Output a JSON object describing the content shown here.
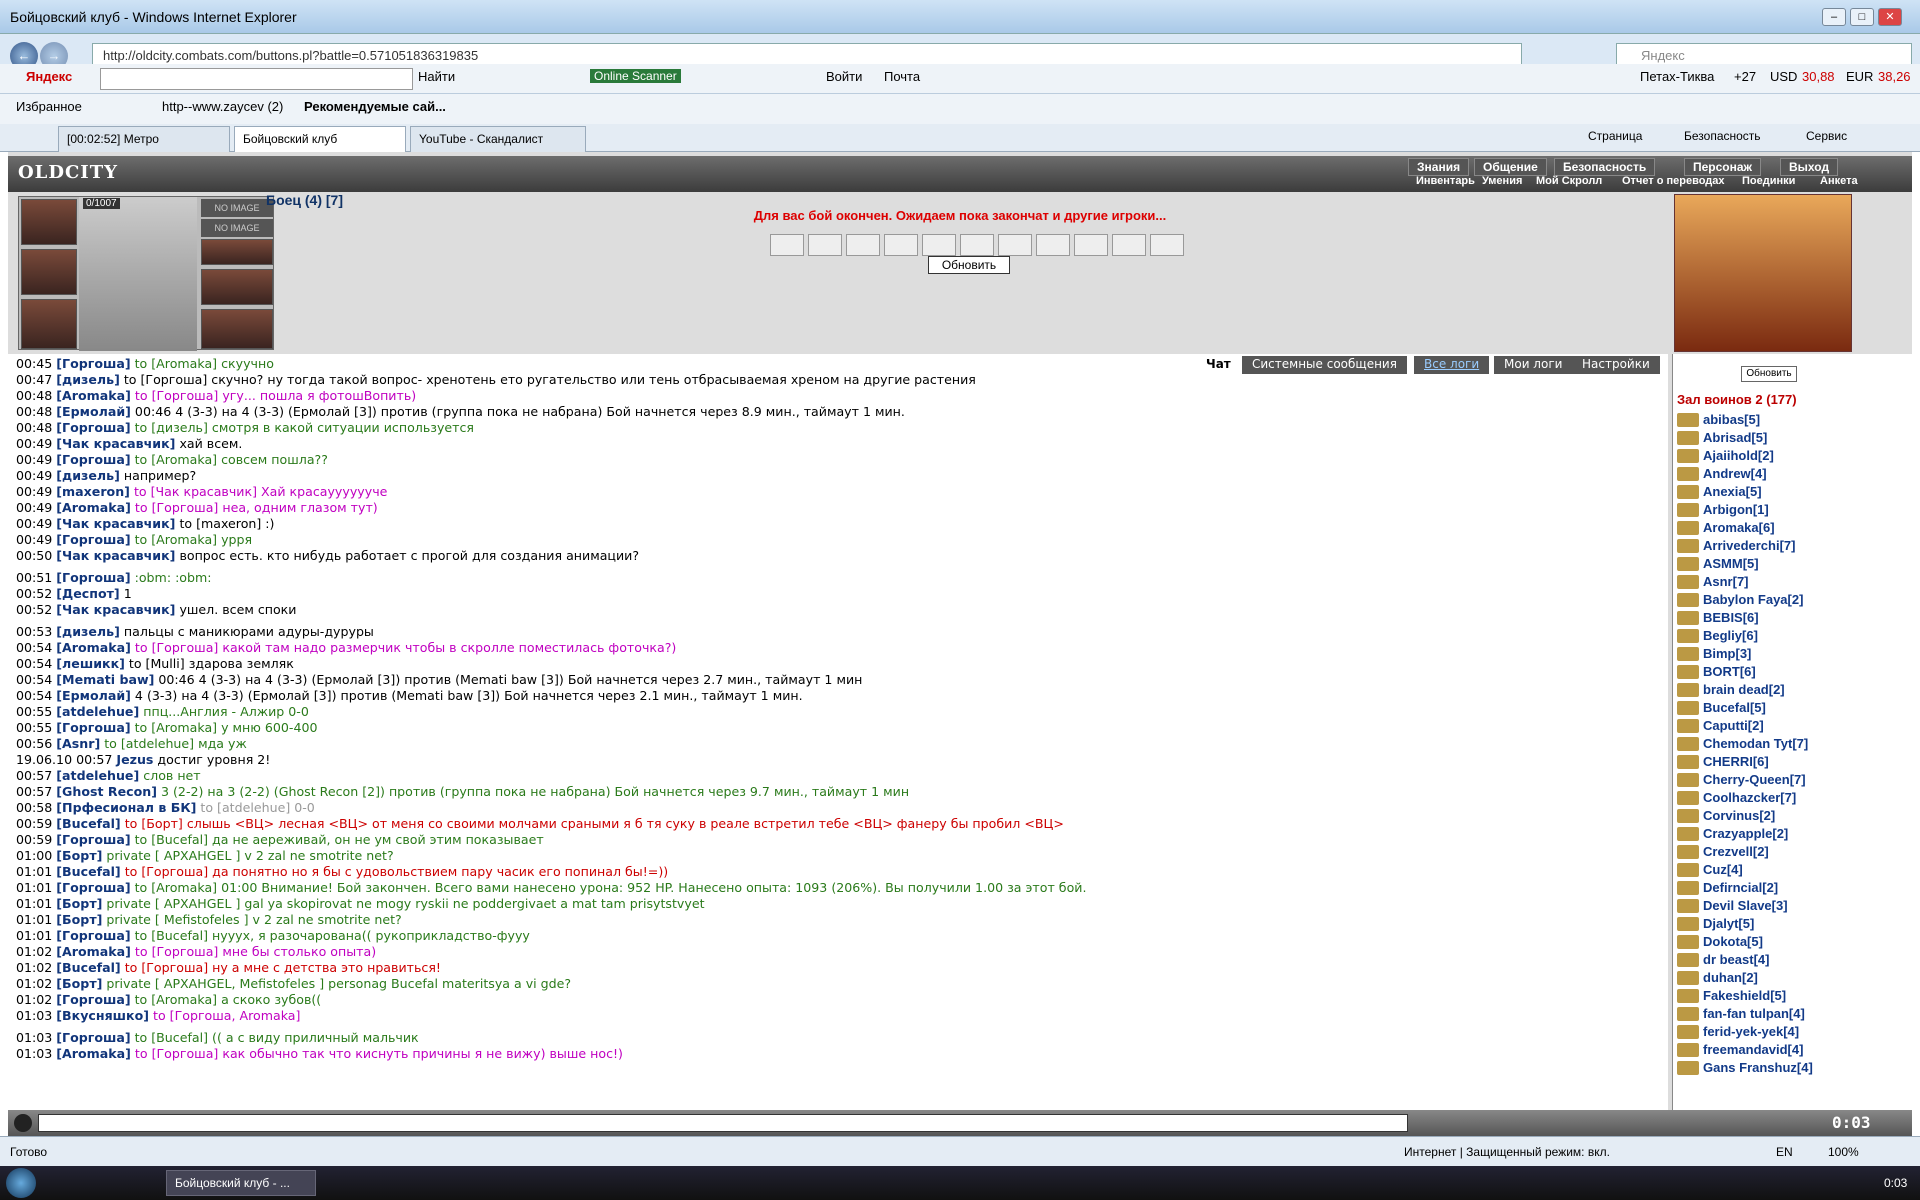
{
  "window": {
    "title": "Бойцовский клуб - Windows Internet Explorer"
  },
  "address": {
    "url": "http://oldcity.combats.com/buttons.pl?battle=0.571051836319835",
    "search_placeholder": "Яндекс"
  },
  "toolbar": {
    "yandex": "Яндекс",
    "find": "Найти",
    "online_scanner": "Online Scanner",
    "login": "Войти",
    "mail": "Почта",
    "location": "Петах-Тиква",
    "temp": "+27",
    "usd_label": "USD",
    "usd": "30,88",
    "eur_label": "EUR",
    "eur": "38,26"
  },
  "favorites": {
    "label": "Избранное",
    "link1": "http--www.zaycev (2)",
    "link2": "Рекомендуемые сай..."
  },
  "tabs": [
    {
      "label": "[00:02:52] Метро"
    },
    {
      "label": "Бойцовский клуб"
    },
    {
      "label": "YouTube - Скандалист"
    }
  ],
  "ie_menu": {
    "page": "Страница",
    "safety": "Безопасность",
    "service": "Сервис"
  },
  "game": {
    "logo": "OLDCITY",
    "menu_top": [
      "Знания",
      "Общение",
      "Безопасность",
      "Персонаж",
      "Выход"
    ],
    "menu_bottom": [
      "Инвентарь",
      "Умения",
      "Мой Скролл",
      "Отчет о переводах",
      "Поединки",
      "Анкета"
    ],
    "hp": "0/1007",
    "no_image": "NO IMAGE",
    "hero": "Боец (4) [7]",
    "battle_message": "Для вас бой окончен. Ожидаем пока закончат и другие игроки...",
    "refresh": "Обновить",
    "chat_tabs": [
      "Чат",
      "Системные сообщения",
      "Все логи",
      "Мои логи",
      "Настройки"
    ],
    "hall": "Зал воинов 2 (177)",
    "side_refresh": "Обновить",
    "time": "0:03"
  },
  "chat": [
    [
      "00:45 ",
      "[Горгоша]",
      " to [Aromaka] скуучно",
      "g"
    ],
    [
      "00:47 ",
      "[дизель]",
      " to [Горгоша] скучно? ну тогда такой вопрос- хренотень ето ругательство или тень отбрасываемая хреном на другие растения",
      "t"
    ],
    [
      "00:48 ",
      "[Aromaka]",
      " to [Горгоша] угу... пошла я фотошВопить)",
      "m"
    ],
    [
      "00:48 ",
      "[Ермолай]",
      " 00:46 4 (3-3) на 4 (3-3) (Ермолай [3]) против (группа пока не набрана) Бой начнется через 8.9 мин., таймаут 1 мин.",
      "t"
    ],
    [
      "00:48 ",
      "[Горгоша]",
      " to [дизель] смотря в какой ситуации используется",
      "g"
    ],
    [
      "00:49 ",
      "[Чак красавчик]",
      " хай всем.",
      "t"
    ],
    [
      "00:49 ",
      "[Горгоша]",
      " to [Aromaka] совсем пошла??",
      "g"
    ],
    [
      "00:49 ",
      "[дизель]",
      " например?",
      "t"
    ],
    [
      "00:49 ",
      "[maxeron]",
      " to [Чак красавчик] Хай красаууууууче",
      "m"
    ],
    [
      "00:49 ",
      "[Aromaka]",
      " to [Горгоша] неа, одним глазом тут)",
      "m"
    ],
    [
      "00:49 ",
      "[Чак красавчик]",
      " to [maxeron] :)",
      "t"
    ],
    [
      "00:49 ",
      "[Горгоша]",
      " to [Aromaka] урря",
      "g"
    ],
    [
      "00:50 ",
      "[Чак красавчик]",
      " вопрос есть. кто нибудь работает с прогой для создания анимации?",
      "t"
    ],
    [
      "00:51 ",
      "[Горгоша]",
      " :obm: :obm:",
      "g"
    ],
    [
      "00:52 ",
      "[Деспот]",
      " 1",
      "t"
    ],
    [
      "00:52 ",
      "[Чак красавчик]",
      " ушел. всем споки",
      "t"
    ],
    [
      "00:53 ",
      "[дизель]",
      " пальцы с маникюрами адуры-дуруры",
      "t"
    ],
    [
      "00:54 ",
      "[Aromaka]",
      " to [Горгоша] какой там надо размерчик чтобы в скролле поместилась фоточка?)",
      "m"
    ],
    [
      "00:54 ",
      "[лешикк]",
      " to [Mulli] здарова земляк",
      "t"
    ],
    [
      "00:54 ",
      "[Memati baw]",
      " 00:46 4 (3-3) на 4 (3-3) (Ермолай [3]) против (Memati baw [3]) Бой начнется через 2.7 мин., таймаут 1 мин",
      "t"
    ],
    [
      "00:54 ",
      "[Ермолай]",
      " 4 (3-3) на 4 (3-3) (Ермолай [3]) против (Memati baw [3]) Бой начнется через 2.1 мин., таймаут 1 мин.",
      "t"
    ],
    [
      "00:55 ",
      "[atdelehue]",
      " ппц...Англия - Алжир 0-0",
      "g"
    ],
    [
      "00:55 ",
      "[Горгоша]",
      " to [Aromaka] у мню 600-400",
      "g"
    ],
    [
      "00:56 ",
      "[Asnr]",
      " to [atdelehue] мда уж",
      "g"
    ],
    [
      "19.06.10 00:57 ",
      "Jezus",
      " достиг уровня 2!",
      "t"
    ],
    [
      "00:57 ",
      "[atdelehue]",
      " слов нет",
      "g"
    ],
    [
      "00:57 ",
      "[Ghost Recon]",
      " 3 (2-2) на 3 (2-2) (Ghost Recon [2]) против (группа пока не набрана) Бой начнется через 9.7 мин., таймаут 1 мин",
      "g"
    ],
    [
      "00:58 ",
      "[Прфесионал в БК]",
      " to [atdelehue]    0-0",
      "gr"
    ],
    [
      "00:59 ",
      "[Bucefal]",
      " to [Борт] слышь <ВЦ> лесная <ВЦ> от меня со своими молчами сраными я б тя суку в реале встретил тебе <ВЦ> фанеру бы пробил <ВЦ>",
      "r"
    ],
    [
      "00:59 ",
      "[Горгоша]",
      " to [Bucefal] да не аереживай, он не ум свой этим показывает",
      "g"
    ],
    [
      "01:00 ",
      "[Борт]",
      " private [ АРХАНGEL ] v 2 zal ne smotrite net?",
      "g"
    ],
    [
      "01:01 ",
      "[Bucefal]",
      " to [Горгоша] да понятно но я бы с удовольствием пару часик его попинал бы!=))",
      "r"
    ],
    [
      "01:01 ",
      "[Горгоша]",
      " to [Aromaka] 01:00 Внимание! Бой закончен. Всего вами нанесено урона: 952 HP. Нанесено опыта: 1093 (206%). Вы получили 1.00 за этот бой.",
      "g"
    ],
    [
      "01:01 ",
      "[Борт]",
      " private [ АРХАНGEL ] gal ya skopirovat ne mogy ryskii ne poddergivaet a mat tam prisytstvyet",
      "g"
    ],
    [
      "01:01 ",
      "[Борт]",
      " private [ Mefistofeles ] v 2 zal ne smotrite net?",
      "g"
    ],
    [
      "01:01 ",
      "[Горгоша]",
      " to [Bucefal] нууух, я разочарована(( рукоприкладство-фууу",
      "g"
    ],
    [
      "01:02 ",
      "[Aromaka]",
      " to [Горгоша] мне бы столько опыта)",
      "m"
    ],
    [
      "01:02 ",
      "[Bucefal]",
      " to [Горгоша] ну а мне с детства это нравиться!",
      "r"
    ],
    [
      "01:02 ",
      "[Борт]",
      " private [ АРХАНGEL, Mefistofeles ] personag Bucefal materitsya a vi gde?",
      "g"
    ],
    [
      "01:02 ",
      "[Горгоша]",
      " to [Aromaka] а скоко зубов((",
      "g"
    ],
    [
      "01:03 ",
      "[Вкусняшко]",
      " to [Горгоша, Aromaka]",
      "m"
    ],
    [
      "01:03 ",
      "[Горгоша]",
      " to [Bucefal] (( а с виду приличный мальчик",
      "g"
    ],
    [
      "01:03 ",
      "[Aromaka]",
      " to [Горгоша] как обычно так что киснуть причины я не вижу) выше нос!)",
      "m"
    ]
  ],
  "players": [
    "abibas[5]",
    "Abrisad[5]",
    "Ajaiihold[2]",
    "Andrew[4]",
    "Anexia[5]",
    "Arbigon[1]",
    "Aromaka[6]",
    "Arrivederchi[7]",
    "ASMM[5]",
    "Asnr[7]",
    "Babylon Faya[2]",
    "BEBIS[6]",
    "Begliy[6]",
    "Bimp[3]",
    "BORT[6]",
    "brain dead[2]",
    "Bucefal[5]",
    "Caputti[2]",
    "Chemodan Tyt[7]",
    "CHERRI[6]",
    "Cherry-Queen[7]",
    "Coolhazcker[7]",
    "Corvinus[2]",
    "Crazyapple[2]",
    "Crezvell[2]",
    "Cuz[4]",
    "Defirncial[2]",
    "Devil Slave[3]",
    "Djalyt[5]",
    "Dokota[5]",
    "dr beast[4]",
    "duhan[2]",
    "Fakeshield[5]",
    "fan-fan tulpan[4]",
    "ferid-yek-yek[4]",
    "freemandavid[4]",
    "Gans Franshuz[4]"
  ],
  "status": {
    "ready": "Готово",
    "zone": "Интернет | Защищенный режим: вкл.",
    "zoom": "100%",
    "lang": "EN"
  },
  "taskbar": {
    "item": "Бойцовский клуб - ...",
    "clock": "0:03"
  }
}
